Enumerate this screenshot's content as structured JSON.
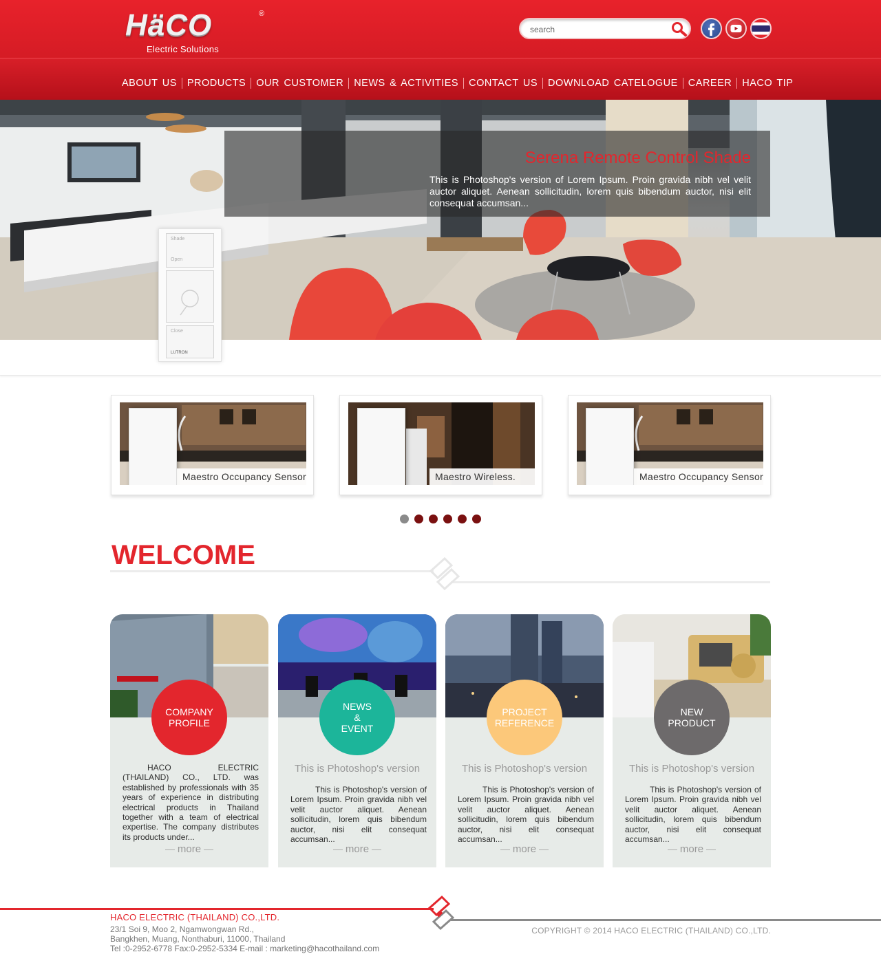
{
  "brand": {
    "logo_text": "HäCO",
    "registered": "®",
    "tagline": "Electric Solutions"
  },
  "search": {
    "placeholder": "search"
  },
  "social": [
    "facebook-icon",
    "youtube-icon",
    "thailand-flag-icon"
  ],
  "nav": [
    "ABOUT US",
    "PRODUCTS",
    "OUR CUSTOMER",
    "NEWS & ACTIVITIES",
    "CONTACT US",
    "DOWNLOAD CATELOGUE",
    "CAREER",
    "HACO TIP"
  ],
  "hero": {
    "title": "Serena Remote Control Shade",
    "text": "This is Photoshop's version  of Lorem Ipsum. Proin gravida nibh vel velit auctor aliquet. Aenean sollicitudin, lorem quis bibendum auctor, nisi elit consequat accumsan...",
    "switch": {
      "top": "Shade",
      "mid": "Open",
      "bottom": "Close",
      "brand": "LUTRON"
    }
  },
  "products": [
    {
      "label": "Maestro Occupancy Sensor"
    },
    {
      "label": "Maestro Wireless."
    },
    {
      "label": "Maestro Occupancy Sensor"
    }
  ],
  "slider": {
    "count": 6,
    "active": 0
  },
  "welcome": {
    "title": "WELCOME"
  },
  "cards": [
    {
      "circle": "COMPANY\nPROFILE",
      "circle_color": "#e3262d",
      "title": "",
      "body": "HACO ELECTRIC (THAILAND) CO., LTD. was established by professionals with 35 years of experience in distributing electrical products in Thailand together with a team of electrical expertise. The company distributes its products under...",
      "more": "more"
    },
    {
      "circle": "NEWS\n&\nEVENT",
      "circle_color": "#1cb59a",
      "title": "This is Photoshop's version",
      "body": "This is Photoshop's version of Lorem Ipsum. Proin gravida nibh vel velit auctor aliquet. Aenean sollicitudin, lorem quis bibendum auctor, nisi elit consequat accumsan...",
      "more": "more"
    },
    {
      "circle": "PROJECT\nREFERENCE",
      "circle_color": "#fcc87a",
      "title": "This is Photoshop's version",
      "body": "This is Photoshop's version of Lorem Ipsum. Proin gravida nibh vel velit auctor aliquet. Aenean sollicitudin, lorem quis bibendum auctor, nisi elit consequat accumsan...",
      "more": "more"
    },
    {
      "circle": "NEW\nPRODUCT",
      "circle_color": "#6d6a6b",
      "title": "This is Photoshop's version",
      "body": "This is Photoshop's version of Lorem Ipsum. Proin gravida nibh vel velit auctor aliquet. Aenean sollicitudin, lorem quis bibendum auctor, nisi elit consequat accumsan...",
      "more": "more"
    }
  ],
  "footer": {
    "company": "HACO ELECTRIC (THAILAND) CO.,LTD.",
    "address": [
      "23/1 Soi 9, Moo 2, Ngamwongwan Rd.,",
      "Bangkhen, Muang, Nonthaburi, 11000, Thailand",
      "Tel :0-2952-6778 Fax:0-2952-5334 E-mail : marketing@hacothailand.com"
    ],
    "copyright": "COPYRIGHT © 2014 HACO ELECTRIC (THAILAND) CO.,LTD."
  },
  "colors": {
    "brand_red": "#e3262d",
    "header_dark": "#b5101a",
    "card_bg": "#e7ebe8"
  }
}
